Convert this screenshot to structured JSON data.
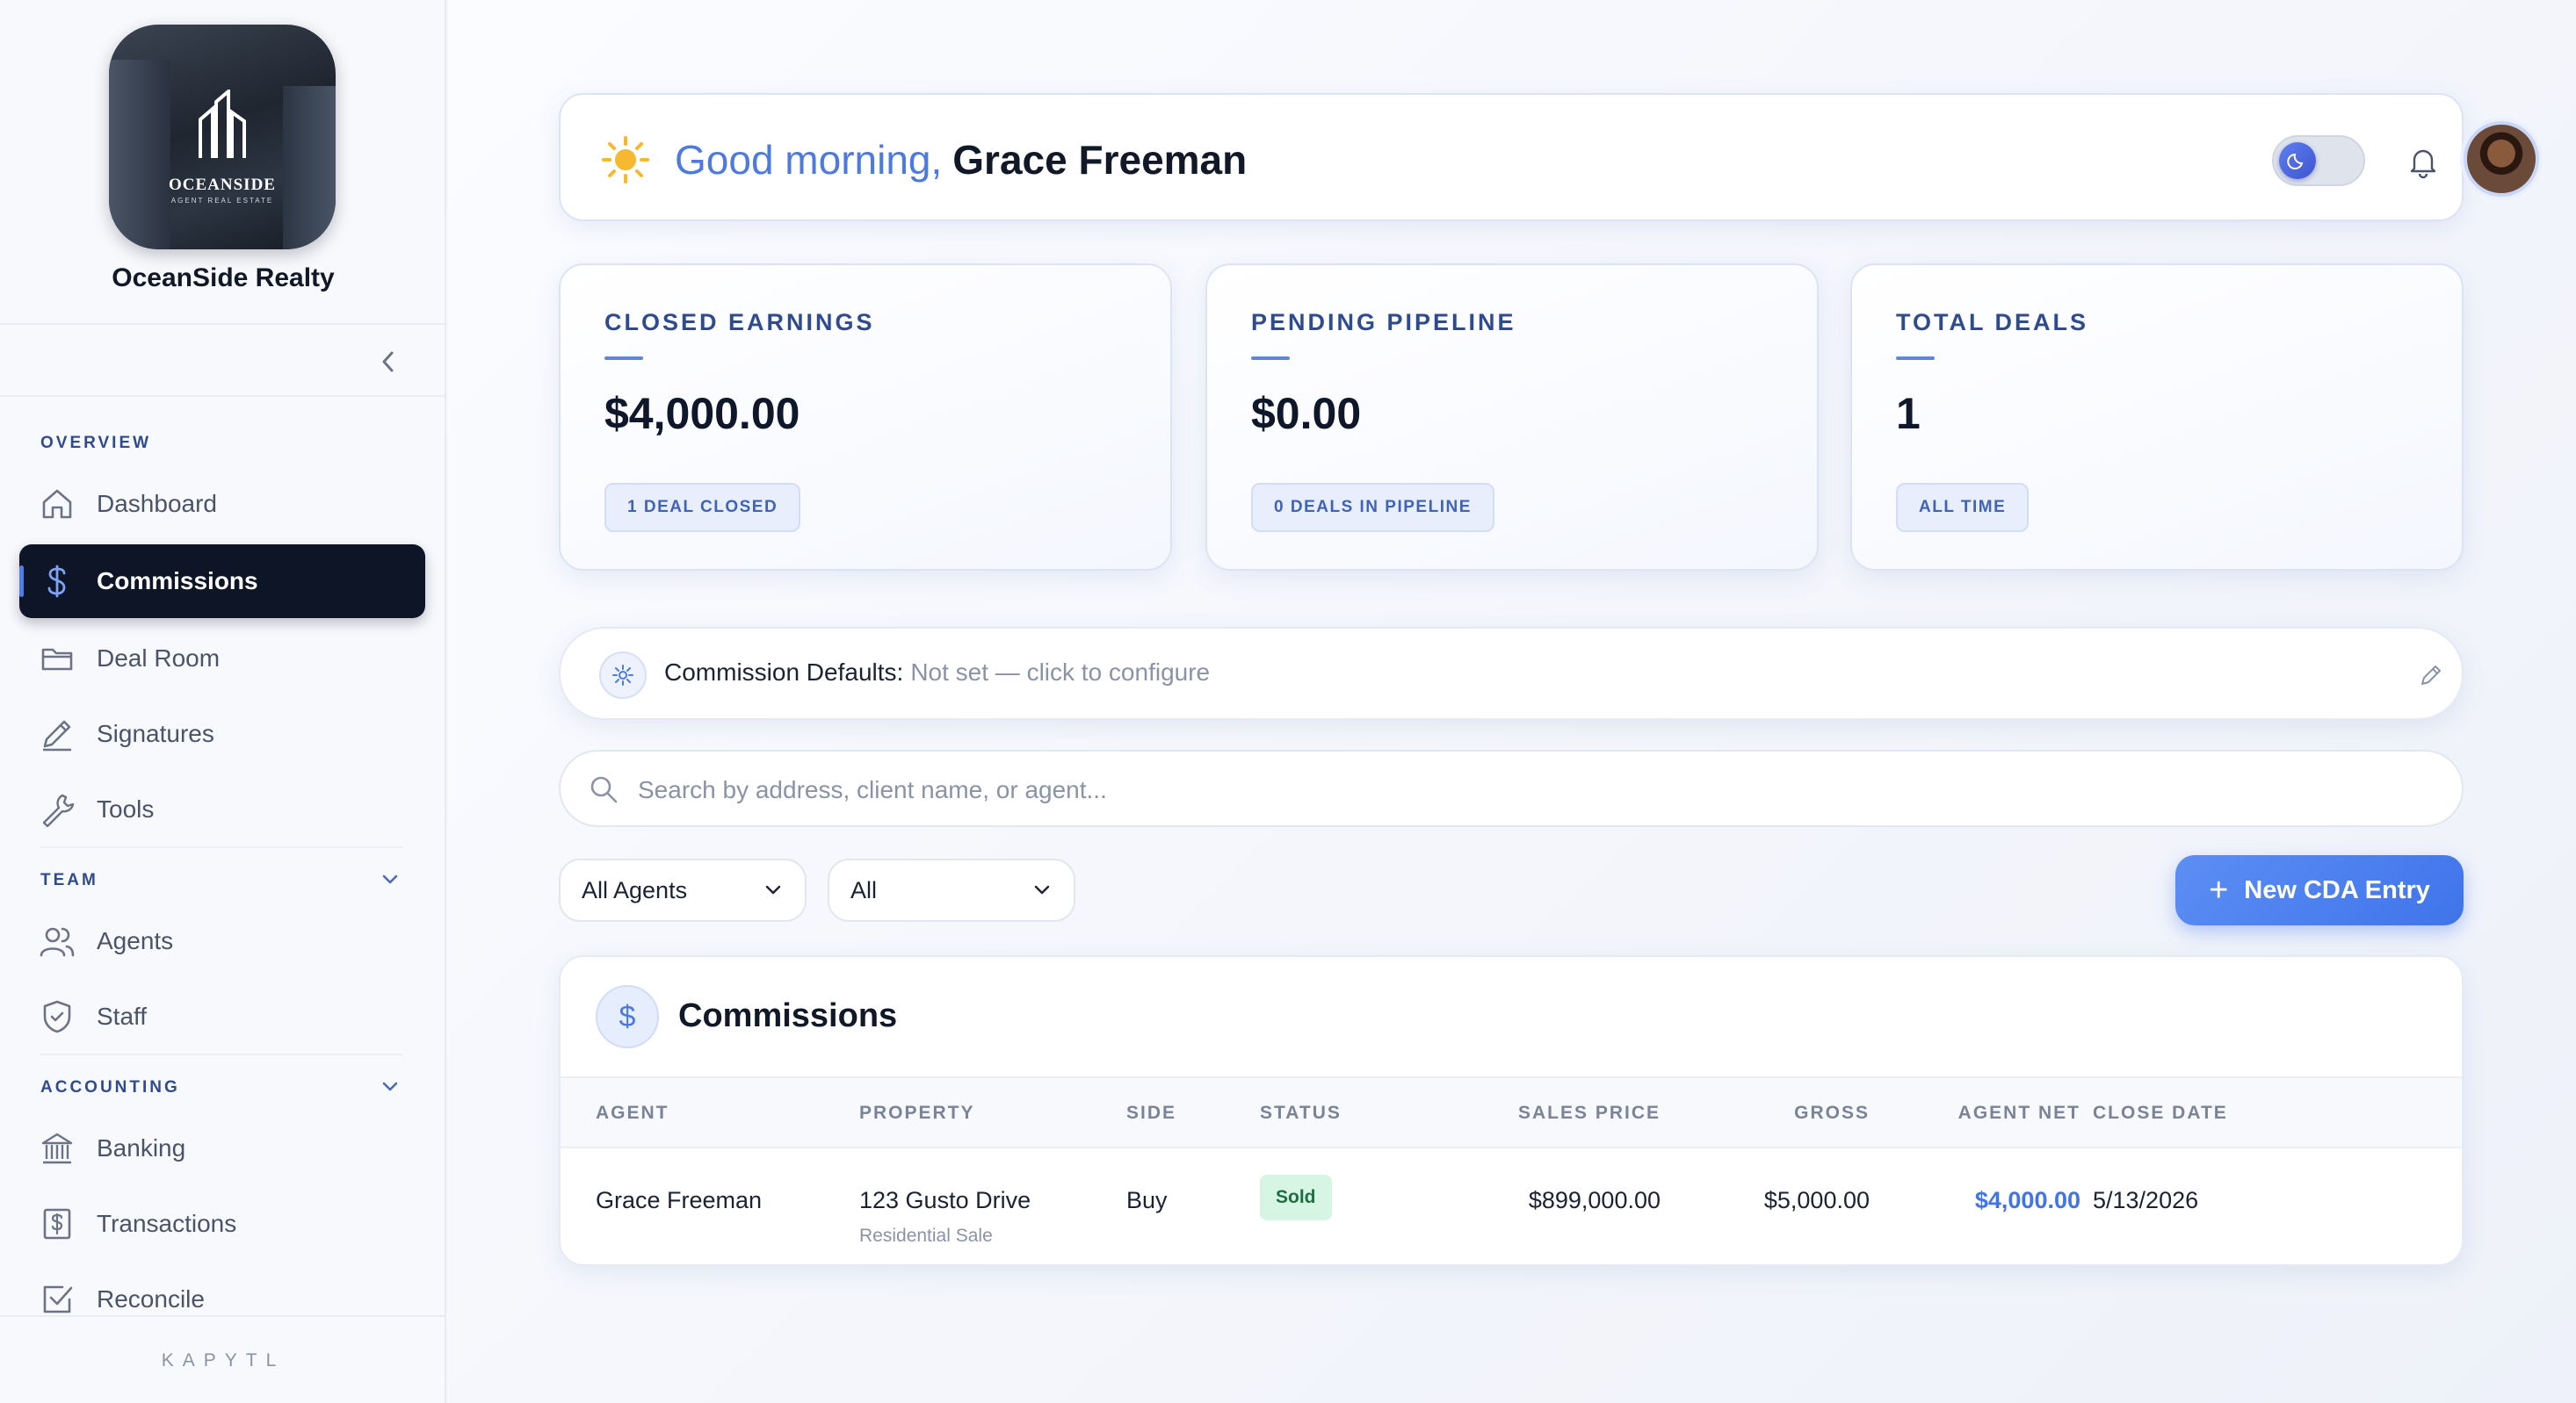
{
  "brand": {
    "logo_text": "OCEANSIDE",
    "logo_subtext": "AGENT REAL ESTATE",
    "name": "OceanSide Realty"
  },
  "sidebar": {
    "sections": {
      "overview": "OVERVIEW",
      "team": "TEAM",
      "accounting": "ACCOUNTING"
    },
    "items": [
      {
        "label": "Dashboard",
        "icon": "home-icon"
      },
      {
        "label": "Commissions",
        "icon": "dollar-icon",
        "active": true
      },
      {
        "label": "Deal Room",
        "icon": "folder-icon"
      },
      {
        "label": "Signatures",
        "icon": "pen-icon"
      },
      {
        "label": "Tools",
        "icon": "wrench-icon"
      },
      {
        "label": "Agents",
        "icon": "users-icon"
      },
      {
        "label": "Staff",
        "icon": "shield-icon"
      },
      {
        "label": "Banking",
        "icon": "bank-icon"
      },
      {
        "label": "Transactions",
        "icon": "receipt-icon"
      },
      {
        "label": "Reconcile",
        "icon": "check-square-icon"
      }
    ],
    "footer": "KAPYTL"
  },
  "header": {
    "greeting": "Good morning,",
    "user_name": "Grace Freeman"
  },
  "stats": [
    {
      "label": "CLOSED EARNINGS",
      "value": "$4,000.00",
      "chip": "1 DEAL CLOSED"
    },
    {
      "label": "PENDING PIPELINE",
      "value": "$0.00",
      "chip": "0 DEALS IN PIPELINE"
    },
    {
      "label": "TOTAL DEALS",
      "value": "1",
      "chip": "ALL TIME"
    }
  ],
  "defaults": {
    "label": "Commission Defaults:",
    "value": "Not set — click to configure"
  },
  "search": {
    "placeholder": "Search by address, client name, or agent..."
  },
  "filters": {
    "agents": "All Agents",
    "status": "All"
  },
  "new_button": "New CDA Entry",
  "table": {
    "title": "Commissions",
    "columns": [
      "AGENT",
      "PROPERTY",
      "SIDE",
      "STATUS",
      "SALES PRICE",
      "GROSS",
      "AGENT NET",
      "CLOSE DATE"
    ],
    "rows": [
      {
        "agent": "Grace Freeman",
        "property": "123 Gusto Drive",
        "property_type": "Residential Sale",
        "side": "Buy",
        "status": "Sold",
        "sales_price": "$899,000.00",
        "gross": "$5,000.00",
        "agent_net": "$4,000.00",
        "close_date": "5/13/2026"
      }
    ]
  },
  "colors": {
    "accent": "#4c7ae0",
    "active_nav": "#0d1526",
    "sold_badge": "#d6f5e3"
  }
}
